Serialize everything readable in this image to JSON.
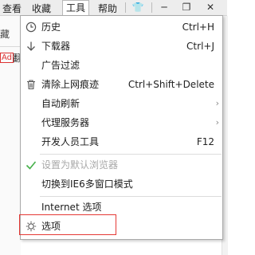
{
  "menubar": {
    "items": [
      {
        "label": "查看"
      },
      {
        "label": "收藏"
      },
      {
        "label": "工具"
      },
      {
        "label": "帮助"
      }
    ],
    "window_buttons": {
      "skin": "👕",
      "minimize": "─",
      "restore": "❐",
      "close": "✕"
    }
  },
  "background": {
    "fragment1": "藏",
    "ad_badge": "Ad",
    "fragment2": "翻"
  },
  "dropdown": {
    "items": [
      {
        "label": "历史",
        "shortcut": "Ctrl+H",
        "icon": "clock-icon"
      },
      {
        "label": "下载器",
        "shortcut": "Ctrl+J",
        "icon": "download-arrow-icon"
      },
      {
        "label": "广告过滤"
      },
      {
        "label": "清除上网痕迹",
        "shortcut": "Ctrl+Shift+Delete",
        "icon": "trash-icon"
      },
      {
        "label": "自动刷新",
        "arrow": "›"
      },
      {
        "label": "代理服务器",
        "arrow": "›"
      },
      {
        "label": "开发人员工具",
        "shortcut": "F12"
      },
      {
        "label": "设置为默认浏览器",
        "disabled": true,
        "icon": "checkmark-icon"
      },
      {
        "label": "切换到IE6多窗口模式"
      },
      {
        "label": "Internet 选项"
      },
      {
        "label": "选项",
        "icon": "gear-icon"
      }
    ]
  },
  "colors": {
    "highlight_border": "#e53935",
    "check_green": "#46b04a"
  }
}
